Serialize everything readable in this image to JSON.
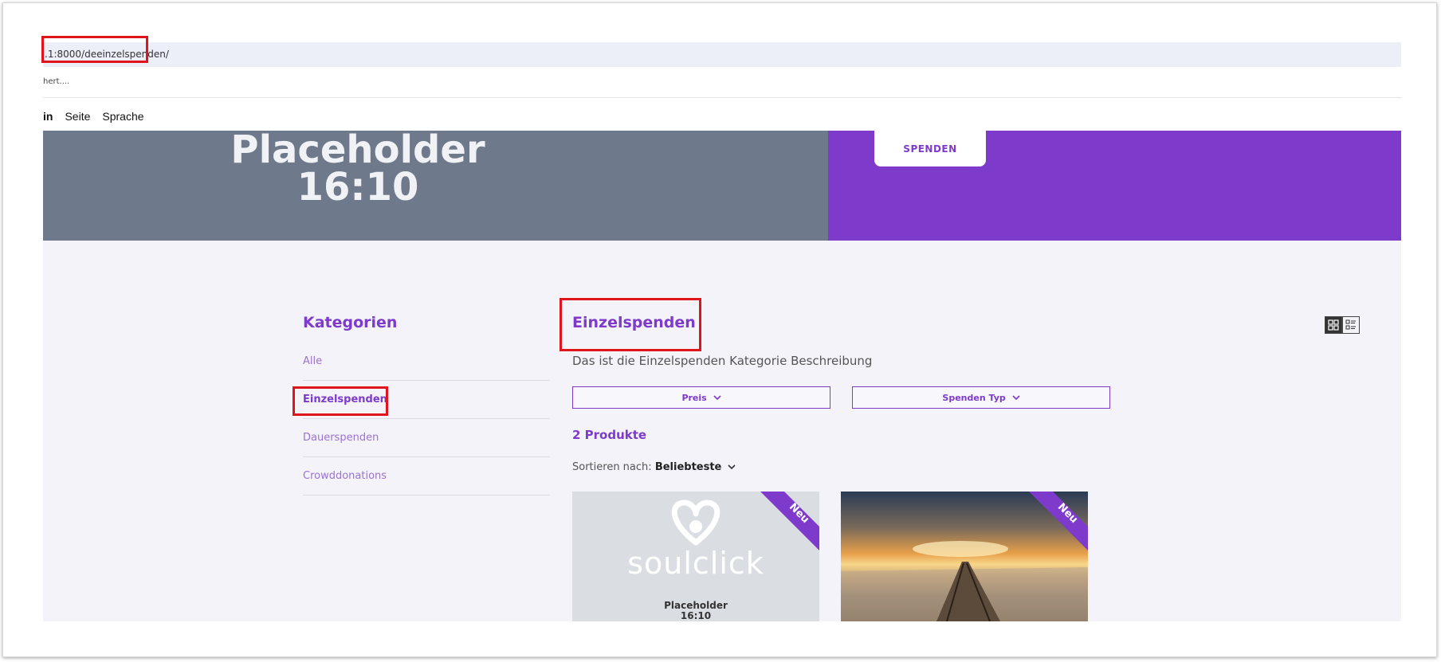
{
  "browser": {
    "url_prefix": ".1:8000/de",
    "url_highlight": "einzelspenden/",
    "subline": "hert....",
    "toolbar": [
      "in",
      "Seite",
      "Sprache"
    ]
  },
  "hero": {
    "placeholder_line1": "Placeholder",
    "placeholder_line2": "16:10",
    "button_label": "SPENDEN",
    "gray_color": "#6e7a8c",
    "purple_color": "#7d3acb"
  },
  "sidebar": {
    "title": "Kategorien",
    "items": [
      {
        "label": "Alle"
      },
      {
        "label": "Einzelspenden"
      },
      {
        "label": "Dauerspenden"
      },
      {
        "label": "Crowddonations"
      }
    ]
  },
  "main": {
    "title": "Einzelspenden",
    "description": "Das ist die Einzelspenden Kategorie Beschreibung",
    "filters": [
      {
        "label": "Preis"
      },
      {
        "label": "Spenden Typ"
      }
    ],
    "product_count": "2 Produkte",
    "sort_label": "Sortieren nach:",
    "sort_value": "Beliebteste",
    "cards": [
      {
        "badge": "Neu",
        "logo_text": "soulclick",
        "placeholder_line1": "Placeholder",
        "placeholder_line2": "16:10"
      },
      {
        "badge": "Neu"
      }
    ]
  },
  "colors": {
    "accent": "#7d3acb",
    "highlight_red": "#e0141d",
    "background": "#f3f3f9"
  }
}
